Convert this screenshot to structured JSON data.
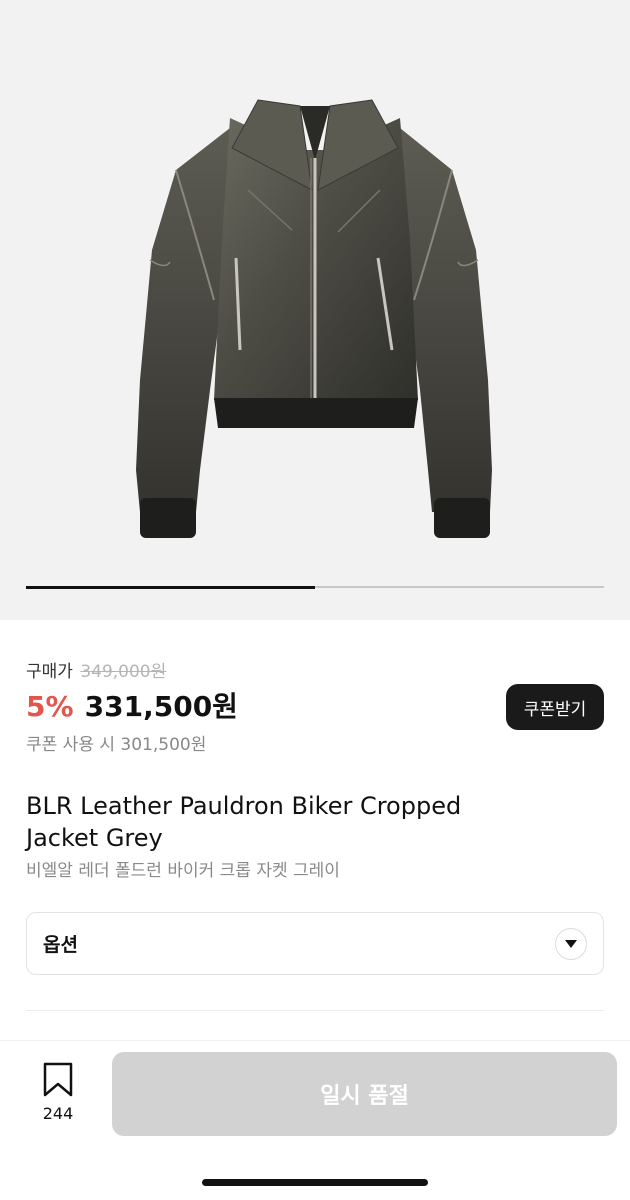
{
  "gallery": {
    "image_alt": "Leather Pauldron Biker Cropped Jacket Grey",
    "slide_progress": 0.5
  },
  "price": {
    "purchase_label": "구매가",
    "original_price": "349,000원",
    "discount": "5%",
    "sale_price": "331,500원",
    "coupon_note": "쿠폰 사용 시 301,500원",
    "coupon_button": "쿠폰받기"
  },
  "product": {
    "title_en_line1": "BLR Leather Pauldron Biker Cropped",
    "title_en_line2": "Jacket Grey",
    "title_ko": "비엘알 레더 폴드런 바이커 크롭 자켓 그레이"
  },
  "options": {
    "label": "옵션",
    "caret_icon": "caret-down-icon"
  },
  "bottom": {
    "bookmark_icon": "bookmark-icon",
    "bookmark_count": "244",
    "soldout_button": "일시 품절"
  }
}
